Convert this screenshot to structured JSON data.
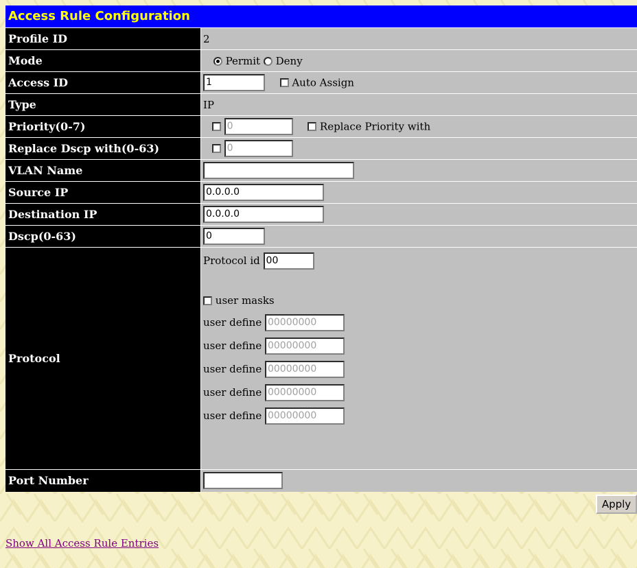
{
  "title": "Access Rule Configuration",
  "fields": {
    "profile_id": {
      "label": "Profile ID",
      "value": "2"
    },
    "mode": {
      "label": "Mode",
      "permit_label": "Permit",
      "deny_label": "Deny",
      "selected": "Permit"
    },
    "access_id": {
      "label": "Access ID",
      "value": "1",
      "auto_assign_label": "Auto Assign",
      "auto_assign_checked": false
    },
    "type": {
      "label": "Type",
      "value": "IP"
    },
    "priority": {
      "label": "Priority(0-7)",
      "value": "0",
      "checked": false,
      "replace_label": "Replace Priority with",
      "replace_checked": false
    },
    "replace_dscp": {
      "label": "Replace Dscp with(0-63)",
      "value": "0",
      "checked": false
    },
    "vlan_name": {
      "label": "VLAN Name",
      "value": ""
    },
    "source_ip": {
      "label": "Source IP",
      "value": "0.0.0.0"
    },
    "destination_ip": {
      "label": "Destination IP",
      "value": "0.0.0.0"
    },
    "dscp": {
      "label": "Dscp(0-63)",
      "value": "0"
    },
    "protocol": {
      "label": "Protocol",
      "protocol_id_label": "Protocol id",
      "protocol_id_value": "00",
      "user_masks_label": "user masks",
      "user_masks_checked": false,
      "user_define_label": "user define",
      "user_define_values": [
        "00000000",
        "00000000",
        "00000000",
        "00000000",
        "00000000"
      ]
    },
    "port_number": {
      "label": "Port Number",
      "value": ""
    }
  },
  "apply_label": "Apply",
  "show_all_link": "Show All Access Rule Entries",
  "colors": {
    "title_bg": "#0000ff",
    "title_text": "#ffff00",
    "label_bg": "#000000",
    "value_bg": "#c0c0c0",
    "page_bg": "#f6f1c9",
    "link": "#800080"
  }
}
